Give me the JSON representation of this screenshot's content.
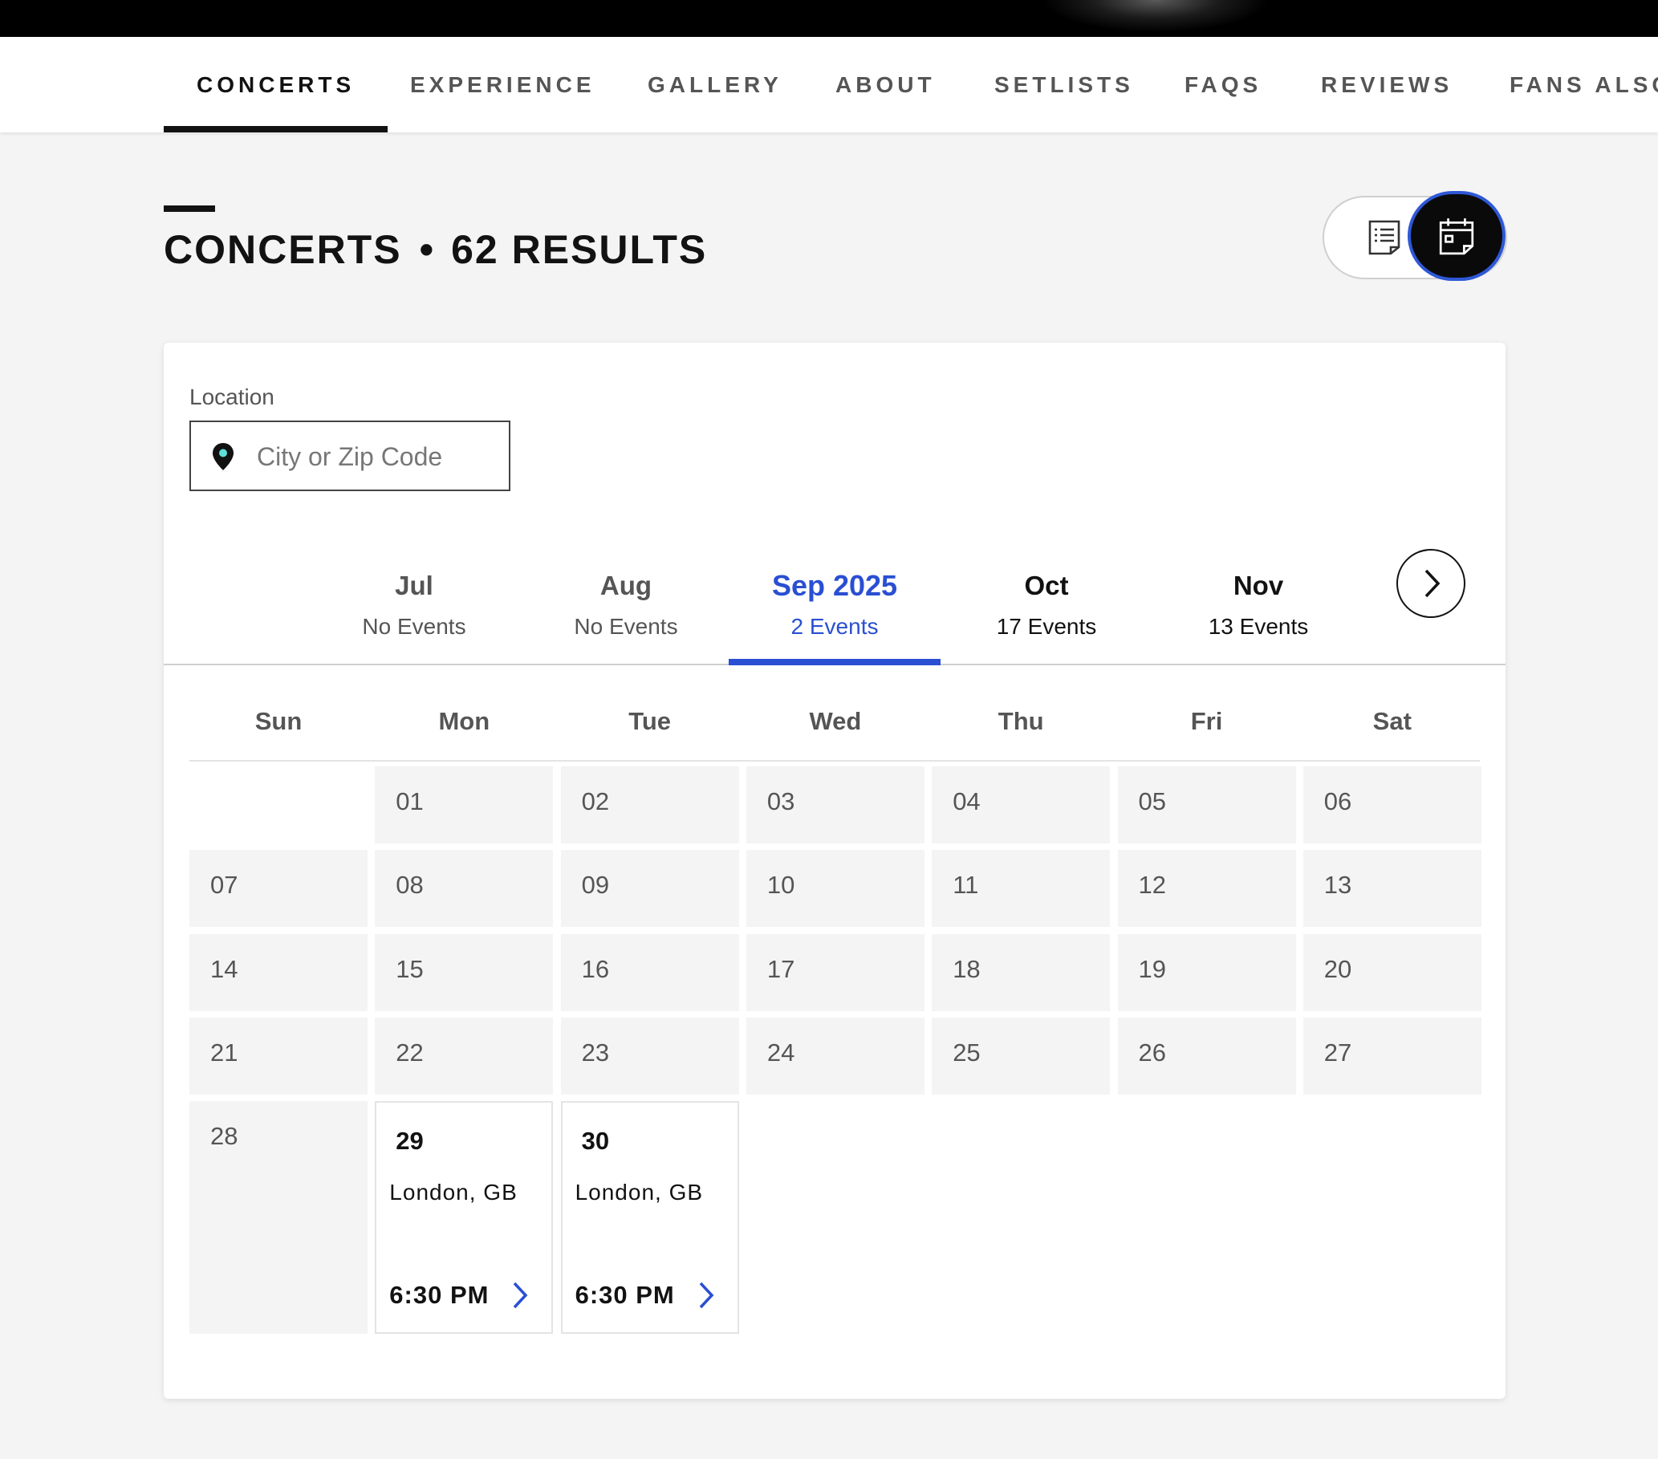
{
  "nav": {
    "tabs": [
      {
        "label": "CONCERTS",
        "active": true
      },
      {
        "label": "EXPERIENCE"
      },
      {
        "label": "GALLERY"
      },
      {
        "label": "ABOUT"
      },
      {
        "label": "SETLISTS"
      },
      {
        "label": "FAQS"
      },
      {
        "label": "REVIEWS"
      },
      {
        "label": "FANS ALSO"
      }
    ]
  },
  "heading": {
    "title": "CONCERTS",
    "separator": "•",
    "count": "62 RESULTS"
  },
  "view_toggle": {
    "selected": "calendar",
    "icons": [
      "list-icon",
      "calendar-icon"
    ]
  },
  "location": {
    "label": "Location",
    "placeholder": "City or Zip Code",
    "value": ""
  },
  "months": [
    {
      "name": "Jul",
      "count": "No Events"
    },
    {
      "name": "Aug",
      "count": "No Events"
    },
    {
      "name": "Sep 2025",
      "count": "2 Events",
      "active": true
    },
    {
      "name": "Oct",
      "count": "17 Events"
    },
    {
      "name": "Nov",
      "count": "13 Events"
    }
  ],
  "weekdays": [
    "Sun",
    "Mon",
    "Tue",
    "Wed",
    "Thu",
    "Fri",
    "Sat"
  ],
  "days": [
    "01",
    "02",
    "03",
    "04",
    "05",
    "06",
    "07",
    "08",
    "09",
    "10",
    "11",
    "12",
    "13",
    "14",
    "15",
    "16",
    "17",
    "18",
    "19",
    "20",
    "21",
    "22",
    "23",
    "24",
    "25",
    "26",
    "27",
    "28",
    "29",
    "30"
  ],
  "events": {
    "29": {
      "city": "London, GB",
      "time": "6:30 PM"
    },
    "30": {
      "city": "London, GB",
      "time": "6:30 PM"
    }
  },
  "colors": {
    "accent": "#2a4fd2",
    "text": "#121212",
    "muted": "#555555",
    "cell_bg": "#f4f4f4",
    "pin_dot": "#5fe0d8"
  }
}
